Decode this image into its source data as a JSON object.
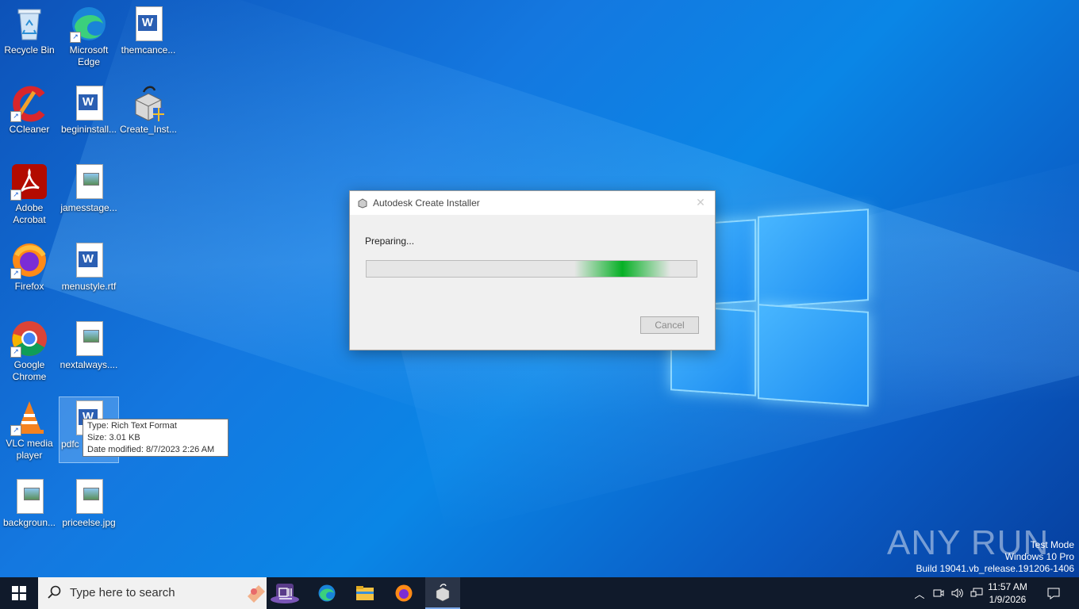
{
  "desktop": {
    "icons": [
      {
        "label": "Recycle Bin",
        "icon": "recycle-bin-icon"
      },
      {
        "label": "Microsoft Edge",
        "icon": "edge-icon"
      },
      {
        "label": "themcance...",
        "icon": "word-doc-icon"
      },
      {
        "label": "CCleaner",
        "icon": "ccleaner-icon"
      },
      {
        "label": "begininstall...",
        "icon": "word-doc-icon"
      },
      {
        "label": "Create_Inst...",
        "icon": "installer-icon"
      },
      {
        "label": "Adobe Acrobat",
        "icon": "acrobat-icon"
      },
      {
        "label": "jamesstage...",
        "icon": "image-file-icon"
      },
      {
        "label": "Firefox",
        "icon": "firefox-icon"
      },
      {
        "label": "menustyle.rtf",
        "icon": "word-doc-icon"
      },
      {
        "label": "Google Chrome",
        "icon": "chrome-icon"
      },
      {
        "label": "nextalways....",
        "icon": "image-file-icon"
      },
      {
        "label": "VLC media player",
        "icon": "vlc-icon"
      },
      {
        "label": "pdfc",
        "icon": "word-doc-icon"
      },
      {
        "label": "backgroun...",
        "icon": "image-file-icon"
      },
      {
        "label": "priceelse.jpg",
        "icon": "image-file-icon"
      }
    ]
  },
  "tooltip": {
    "type": "Type: Rich Text Format",
    "size": "Size: 3.01 KB",
    "date": "Date modified: 8/7/2023 2:26 AM"
  },
  "dialog": {
    "title": "Autodesk Create Installer",
    "status": "Preparing...",
    "cancel_label": "Cancel",
    "progress_highlight": {
      "start": 0.63,
      "end": 0.92
    }
  },
  "watermark": {
    "mode": "Test Mode",
    "edition": "Windows 10 Pro",
    "build": "Build 19041.vb_release.191206-1406",
    "brand": "ANY RUN"
  },
  "taskbar": {
    "search_placeholder": "Type here to search",
    "time": "11:57 AM",
    "date": "1/9/2026"
  }
}
